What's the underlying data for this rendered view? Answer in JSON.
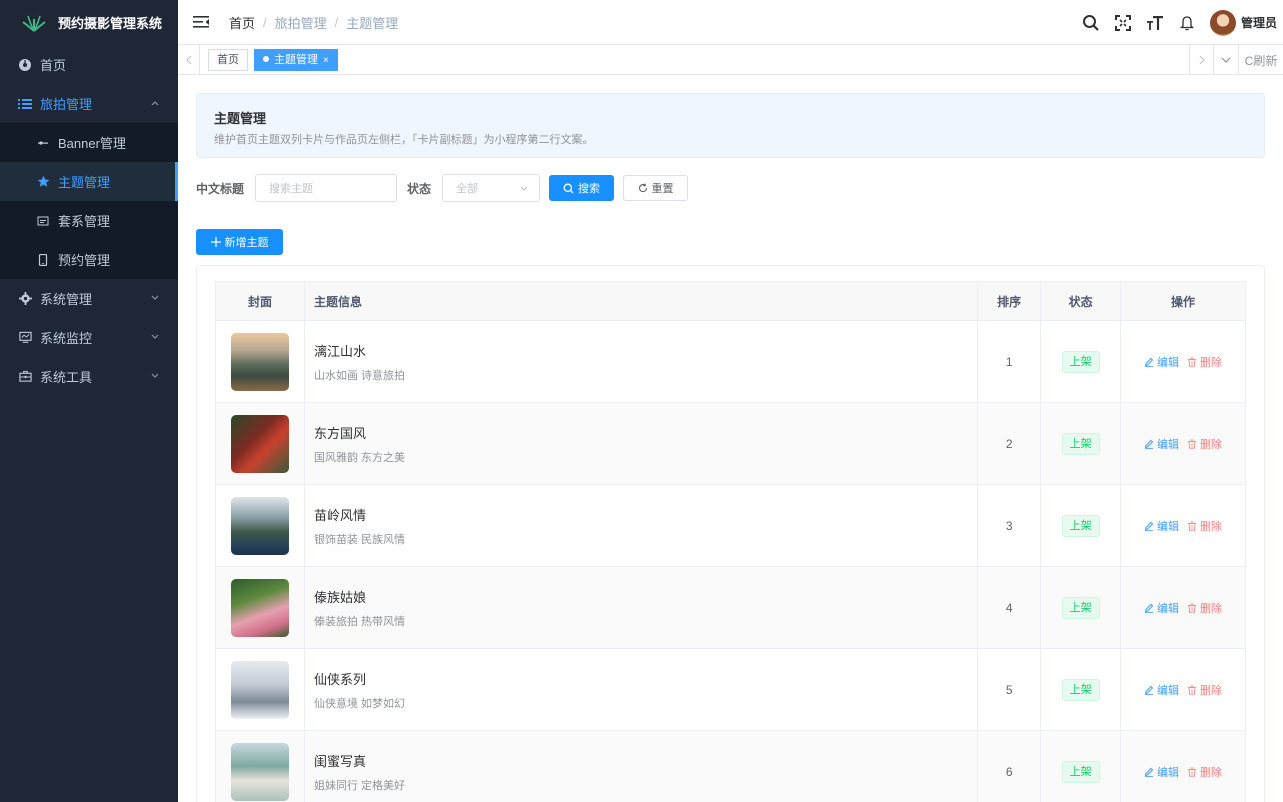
{
  "app": {
    "title": "预约摄影管理系统"
  },
  "sidebar": {
    "items": [
      {
        "label": "首页"
      },
      {
        "label": "旅拍管理"
      },
      {
        "label": "Banner管理"
      },
      {
        "label": "主题管理"
      },
      {
        "label": "套系管理"
      },
      {
        "label": "预约管理"
      },
      {
        "label": "系统管理"
      },
      {
        "label": "系统监控"
      },
      {
        "label": "系统工具"
      }
    ]
  },
  "header": {
    "breadcrumb": [
      "首页",
      "旅拍管理",
      "主题管理"
    ],
    "username": "管理员"
  },
  "tags": {
    "home": "首页",
    "active": "主题管理",
    "close": "×",
    "refresh": "C刷新"
  },
  "page": {
    "title": "主题管理",
    "description": "维护首页主题双列卡片与作品页左侧栏，「卡片副标题」为小程序第二行文案。"
  },
  "filters": {
    "title_label": "中文标题",
    "title_placeholder": "搜索主题",
    "status_label": "状态",
    "status_value": "全部",
    "search_label": "搜索",
    "reset_label": "重置"
  },
  "toolbar": {
    "add_label": "新增主题"
  },
  "table": {
    "columns": [
      "封面",
      "主题信息",
      "排序",
      "状态",
      "操作"
    ],
    "edit_label": "编辑",
    "delete_label": "删除",
    "rows": [
      {
        "name": "漓江山水",
        "subtitle": "山水如画 诗意旅拍",
        "sort": "1",
        "status": "上架"
      },
      {
        "name": "东方国风",
        "subtitle": "国风雅韵 东方之美",
        "sort": "2",
        "status": "上架"
      },
      {
        "name": "苗岭风情",
        "subtitle": "银饰苗装 民族风情",
        "sort": "3",
        "status": "上架"
      },
      {
        "name": "傣族姑娘",
        "subtitle": "傣装旅拍 热带风情",
        "sort": "4",
        "status": "上架"
      },
      {
        "name": "仙侠系列",
        "subtitle": "仙侠意境 如梦如幻",
        "sort": "5",
        "status": "上架"
      },
      {
        "name": "闺蜜写真",
        "subtitle": "姐妹同行 定格美好",
        "sort": "6",
        "status": "上架"
      }
    ]
  },
  "colors": {
    "sidebar_bg": "#1f2737",
    "accent": "#409eff",
    "primary_button": "#1890ff",
    "status_green": "#13ce66",
    "delete_red": "#ff7d7d"
  }
}
